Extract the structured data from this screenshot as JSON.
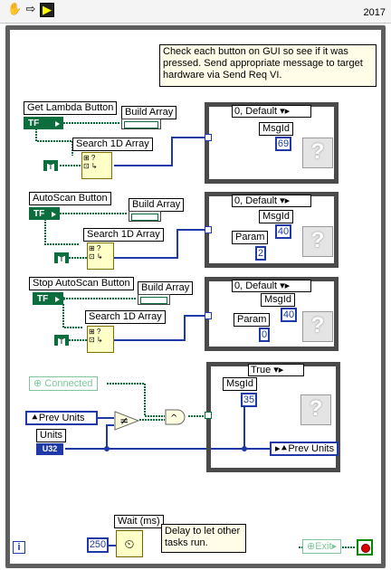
{
  "toolbar": {
    "icons": [
      "hand-icon",
      "arrow-right-icon",
      "run-highlight-icon"
    ],
    "version": "2017"
  },
  "comment_top": "Check each button on GUI so see if it was pressed.  Send appropriate message to target hardware via Send Req VI.",
  "buttons": [
    {
      "label": "Get Lambda Button",
      "build_array": "Build Array",
      "search": "Search 1D Array",
      "case_selector": "0, Default",
      "msgid_label": "MsgId",
      "msgid_value": "69"
    },
    {
      "label": "AutoScan Button",
      "build_array": "Build Array",
      "search": "Search 1D Array",
      "case_selector": "0, Default",
      "msgid_label": "MsgId",
      "msgid_value": "40",
      "param_label": "Param",
      "param_value": "2"
    },
    {
      "label": "Stop AutoScan Button",
      "build_array": "Build Array",
      "search": "Search 1D Array",
      "case_selector": "0, Default",
      "msgid_label": "MsgId",
      "msgid_value": "40",
      "param_label": "Param",
      "param_value": "0"
    }
  ],
  "tf_text": "TF",
  "t_text": "T",
  "connected_label": "Connected",
  "prev_units_label": "Prev Units",
  "units_label": "Units",
  "u32_text": "U32",
  "case4": {
    "selector": "True",
    "msgid_label": "MsgId",
    "msgid_value": "35",
    "prev_units": "Prev Units"
  },
  "wait": {
    "label": "Wait (ms)",
    "value": "250",
    "comment": "Delay to let other tasks run."
  },
  "exit_label": "Exit",
  "iteration": "i",
  "colors": {
    "boolean": "#0b6e3c",
    "numeric": "#1f3aa8",
    "frame": "#4a4a4a"
  }
}
